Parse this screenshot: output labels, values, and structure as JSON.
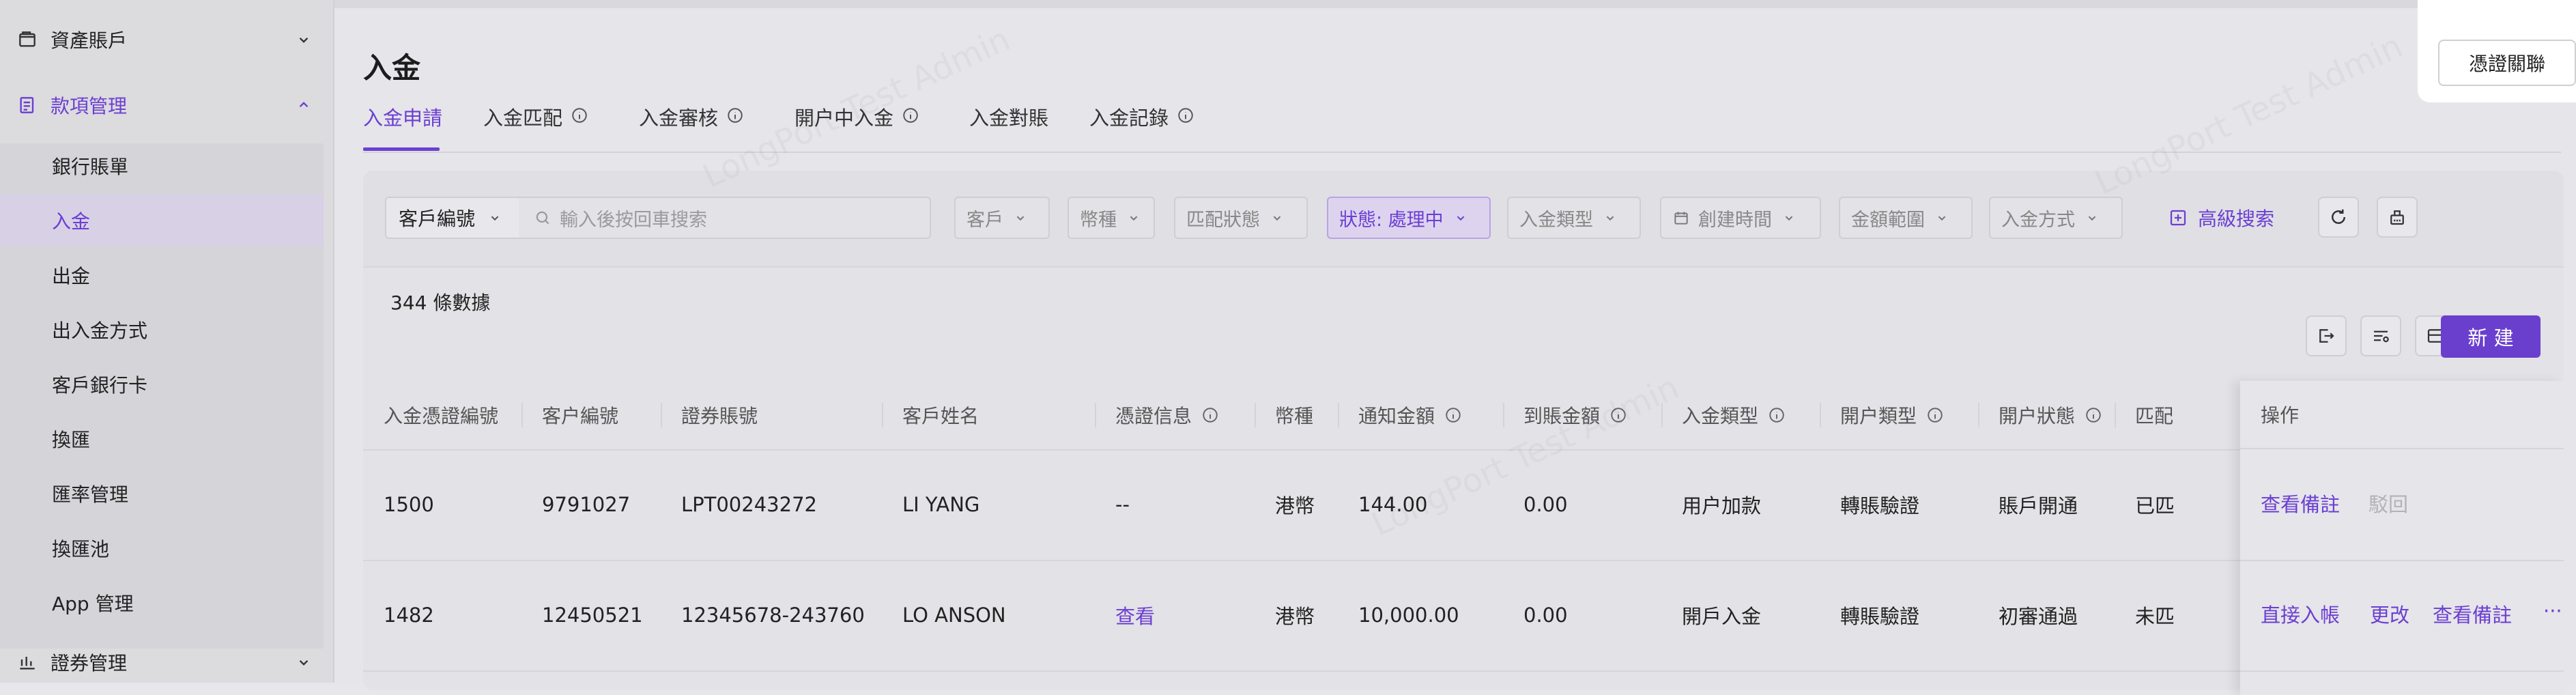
{
  "sidebar": {
    "groups": [
      {
        "label": "資產賬戶",
        "icon": "wallet-icon",
        "expanded": false
      },
      {
        "label": "款項管理",
        "icon": "ledger-icon",
        "expanded": true
      },
      {
        "label": "證券管理",
        "icon": "securities-icon",
        "expanded": false
      }
    ],
    "items": [
      {
        "label": "銀行賬單",
        "active": false
      },
      {
        "label": "入金",
        "active": true
      },
      {
        "label": "出金",
        "active": false
      },
      {
        "label": "出入金方式",
        "active": false
      },
      {
        "label": "客戶銀行卡",
        "active": false
      },
      {
        "label": "換匯",
        "active": false
      },
      {
        "label": "匯率管理",
        "active": false
      },
      {
        "label": "換匯池",
        "active": false
      },
      {
        "label": "App 管理",
        "active": false
      }
    ]
  },
  "header": {
    "title": "入金",
    "voucher_button": "憑證關聯"
  },
  "tabs": [
    {
      "label": "入金申請",
      "active": true,
      "info": false
    },
    {
      "label": "入金匹配",
      "active": false,
      "info": true
    },
    {
      "label": "入金審核",
      "active": false,
      "info": true
    },
    {
      "label": "開户中入金",
      "active": false,
      "info": true
    },
    {
      "label": "入金對賬",
      "active": false,
      "info": false
    },
    {
      "label": "入金記錄",
      "active": false,
      "info": true
    }
  ],
  "filters": {
    "customer_select": "客戶編號",
    "search_placeholder": "輸入後按回車搜索",
    "customer": "客戶",
    "currency": "幣種",
    "match_status": "匹配狀態",
    "status": "狀態: 處理中",
    "deposit_type": "入金類型",
    "created_time": "創建時間",
    "amount_range": "金額範圍",
    "deposit_method": "入金方式",
    "advanced_search": "高級搜索"
  },
  "toolbar": {
    "record_count": "344 條數據",
    "new_button": "新 建"
  },
  "table": {
    "columns": [
      "入金憑證編號",
      "客户編號",
      "證券賬號",
      "客戶姓名",
      "憑證信息",
      "幣種",
      "通知金額",
      "到賬金額",
      "入金類型",
      "開户類型",
      "開户狀態",
      "匹配"
    ],
    "ops_header": "操作",
    "rows": [
      {
        "voucher_no": "1500",
        "customer_no": "9791027",
        "securities_account": "LPT00243272",
        "customer_name": "LI YANG",
        "voucher_info": "--",
        "currency": "港幣",
        "notice_amount": "144.00",
        "received_amount": "0.00",
        "deposit_type": "用户加款",
        "open_type": "轉賬驗證",
        "open_status": "賬戶開通",
        "match": "已匹",
        "ops": [
          {
            "label": "查看備註",
            "enabled": true
          },
          {
            "label": "駁回",
            "enabled": false
          }
        ]
      },
      {
        "voucher_no": "1482",
        "customer_no": "12450521",
        "securities_account": "12345678-243760",
        "customer_name": "LO ANSON",
        "voucher_info": "查看",
        "currency": "港幣",
        "notice_amount": "10,000.00",
        "received_amount": "0.00",
        "deposit_type": "開戶入金",
        "open_type": "轉賬驗證",
        "open_status": "初審通過",
        "match": "未匹",
        "ops": [
          {
            "label": "直接入帳",
            "enabled": true
          },
          {
            "label": "更改",
            "enabled": true
          },
          {
            "label": "查看備註",
            "enabled": true
          },
          {
            "label": "···",
            "enabled": true
          }
        ]
      }
    ]
  },
  "watermark_text": "LongPort Test Admin",
  "colors": {
    "accent": "#6b3fd3",
    "active_bg": "#d8d0e5"
  }
}
